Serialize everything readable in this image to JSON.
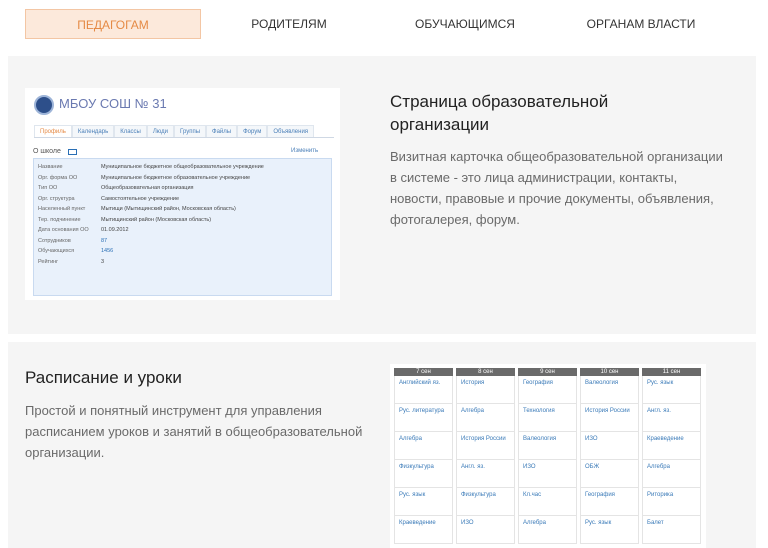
{
  "tabs": [
    {
      "label": "ПЕДАГОГАМ",
      "active": true
    },
    {
      "label": "РОДИТЕЛЯМ",
      "active": false
    },
    {
      "label": "ОБУЧАЮЩИМСЯ",
      "active": false
    },
    {
      "label": "ОРГАНАМ ВЛАСТИ",
      "active": false
    }
  ],
  "section1": {
    "title": "Страница образовательной организации",
    "description": "Визитная карточка общеобразовательной организации в системе - это лица администрации, контакты, новости, правовые и прочие документы, объявления, фотогалерея, форум.",
    "card": {
      "school_name": "МБОУ СОШ № 31",
      "tabs": [
        "Профиль",
        "Календарь",
        "Классы",
        "Люди",
        "Группы",
        "Файлы",
        "Форум",
        "Объявления"
      ],
      "about_label": "О школе",
      "edit_label": "Изменить",
      "rows": [
        {
          "k": "Название",
          "v": "Муниципальное бюджетное общеобразовательное учреждение"
        },
        {
          "k": "Орг. форма ОО",
          "v": "Муниципальное бюджетное образовательное учреждение"
        },
        {
          "k": "Тип ОО",
          "v": "Общеобразовательная организация"
        },
        {
          "k": "Орг. структура",
          "v": "Самостоятельное учреждение"
        },
        {
          "k": "Населенный пункт",
          "v": "Мытищи (Мытищинский район, Московская область)"
        },
        {
          "k": "Тер. подчинение",
          "v": "Мытищинский район (Московская область)"
        },
        {
          "k": "Дата основания ОО",
          "v": "01.09.2012"
        },
        {
          "k": "Сотрудников",
          "v": "87"
        },
        {
          "k": "Обучающихся",
          "v": "1456"
        },
        {
          "k": "Рейтинг",
          "v": "3"
        }
      ]
    }
  },
  "section2": {
    "title": "Расписание и уроки",
    "description": "Простой и понятный инструмент для управления расписанием уроков и занятий в общеобразовательной организации.",
    "schedule": {
      "days": [
        "7 сен",
        "8 сен",
        "9 сен",
        "10 сен",
        "11 сен"
      ],
      "cells": [
        [
          "Английский яз.",
          "История",
          "География",
          "Валеология",
          "Рус. язык"
        ],
        [
          "Рус. литература",
          "Алгебра",
          "Технология",
          "История России",
          "Англ. яз."
        ],
        [
          "Алгебра",
          "История России",
          "Валеология",
          "ИЗО",
          "Краеведение"
        ],
        [
          "Физкультура",
          "Англ. яз.",
          "ИЗО",
          "ОБЖ",
          "Алгебра"
        ],
        [
          "Рус. язык",
          "Физкультура",
          "Кл.час",
          "География",
          "Риторика"
        ],
        [
          "Краеведение",
          "ИЗО",
          "Алгебра",
          "Рус. язык",
          "Балет"
        ]
      ]
    }
  }
}
